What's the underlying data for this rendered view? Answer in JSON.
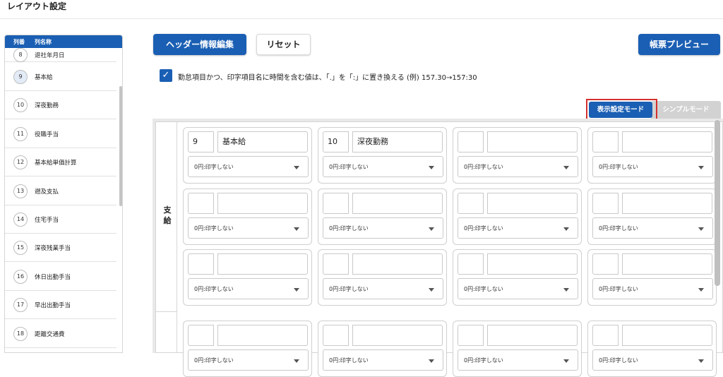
{
  "page_title": "レイアウト設定",
  "sidebar": {
    "header_num": "列番",
    "header_name": "列名称",
    "items": [
      {
        "num": "8",
        "label": "退社年月日"
      },
      {
        "num": "9",
        "label": "基本給"
      },
      {
        "num": "10",
        "label": "深夜勤務"
      },
      {
        "num": "11",
        "label": "役職手当"
      },
      {
        "num": "12",
        "label": "基本給単価計算"
      },
      {
        "num": "13",
        "label": "遡及支払"
      },
      {
        "num": "14",
        "label": "住宅手当"
      },
      {
        "num": "15",
        "label": "深夜残業手当"
      },
      {
        "num": "16",
        "label": "休日出勤手当"
      },
      {
        "num": "17",
        "label": "早出出勤手当"
      },
      {
        "num": "18",
        "label": "距離交通費"
      }
    ]
  },
  "toolbar": {
    "header_edit_label": "ヘッダー情報編集",
    "reset_label": "リセット",
    "preview_label": "帳票プレビュー"
  },
  "option": {
    "checked": true,
    "text": "勤怠項目かつ、印字項目名に時間を含む値は、「.」を「:」に置き換える (例) 157.30→157:30"
  },
  "mode_tabs": {
    "display_label": "表示設定モード",
    "simple_label": "シンプルモード",
    "active": "display"
  },
  "grid": {
    "section_label": "支給",
    "select_default": "0円:印字しない",
    "rows": [
      [
        {
          "num": "9",
          "name": "基本給"
        },
        {
          "num": "10",
          "name": "深夜勤務"
        },
        {
          "num": "",
          "name": ""
        },
        {
          "num": "",
          "name": ""
        }
      ],
      [
        {
          "num": "",
          "name": ""
        },
        {
          "num": "",
          "name": ""
        },
        {
          "num": "",
          "name": ""
        },
        {
          "num": "",
          "name": ""
        }
      ],
      [
        {
          "num": "",
          "name": ""
        },
        {
          "num": "",
          "name": ""
        },
        {
          "num": "",
          "name": ""
        },
        {
          "num": "",
          "name": ""
        }
      ],
      [
        {
          "num": "",
          "name": ""
        },
        {
          "num": "",
          "name": ""
        },
        {
          "num": "",
          "name": ""
        },
        {
          "num": "",
          "name": ""
        }
      ]
    ]
  },
  "colors": {
    "primary": "#1a5fb4",
    "highlight": "#d32f2f"
  }
}
